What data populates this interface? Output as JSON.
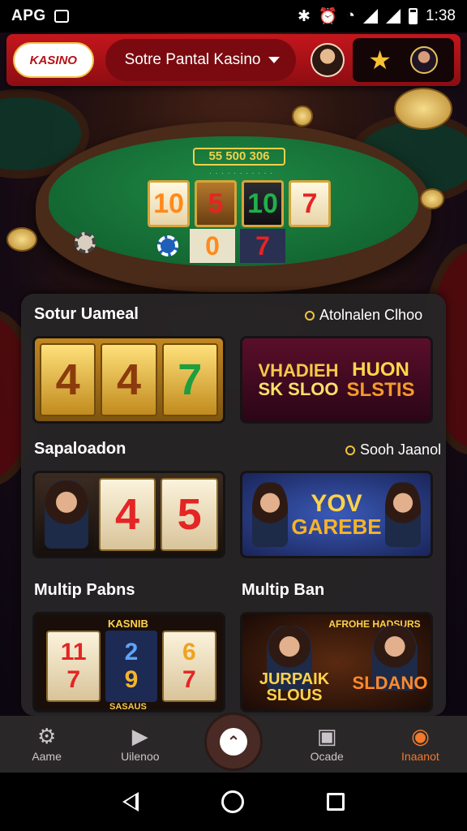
{
  "status_bar": {
    "carrier": "APG",
    "time": "1:38"
  },
  "header": {
    "logo_text": "KASINO",
    "selector_label": "Sotre Pantal Kasino",
    "icons": [
      "avatar",
      "star-icon",
      "avatar"
    ]
  },
  "table": {
    "number": "55 500 306",
    "reels_top": [
      "10",
      "5",
      "10",
      "7"
    ],
    "reels_bottom": [
      "0",
      "7"
    ]
  },
  "sections": [
    {
      "title": "Sotur Uameal",
      "link": "Atolnalen Clhoo"
    },
    {
      "title": "Sapaloadon",
      "link": "Sooh Jaanol"
    },
    {
      "title": "Multip Pabns",
      "link": "Multip Ban"
    }
  ],
  "cards": {
    "c1": [
      "4",
      "4",
      "7"
    ],
    "c2": {
      "line1": "VHADIEH",
      "line2": "SK SLOO",
      "right1": "HUON",
      "right2": "SLSTIS"
    },
    "c3": [
      "4",
      "5"
    ],
    "c4": {
      "line1": "YOV",
      "line2": "GAREBE"
    },
    "c5": {
      "header": "KASNIB",
      "digits": [
        "11",
        "2",
        "6",
        "7",
        "9",
        "7"
      ],
      "footer": "SASAUS"
    },
    "c6": {
      "header": "AFROHE HADSURS",
      "left": "JURPAIK SLOUS",
      "right": "SLDANO"
    }
  },
  "bottom_nav": [
    {
      "label": "Aame",
      "icon": "gear-icon"
    },
    {
      "label": "Uilenoo",
      "icon": "play-icon"
    },
    {
      "label": "",
      "icon": "smile-icon"
    },
    {
      "label": "Ocade",
      "icon": "badge-icon"
    },
    {
      "label": "Inaanot",
      "icon": "coin-icon"
    }
  ],
  "colors": {
    "accent": "#c4161c",
    "active": "#f27a2a",
    "panel": "#262426"
  }
}
